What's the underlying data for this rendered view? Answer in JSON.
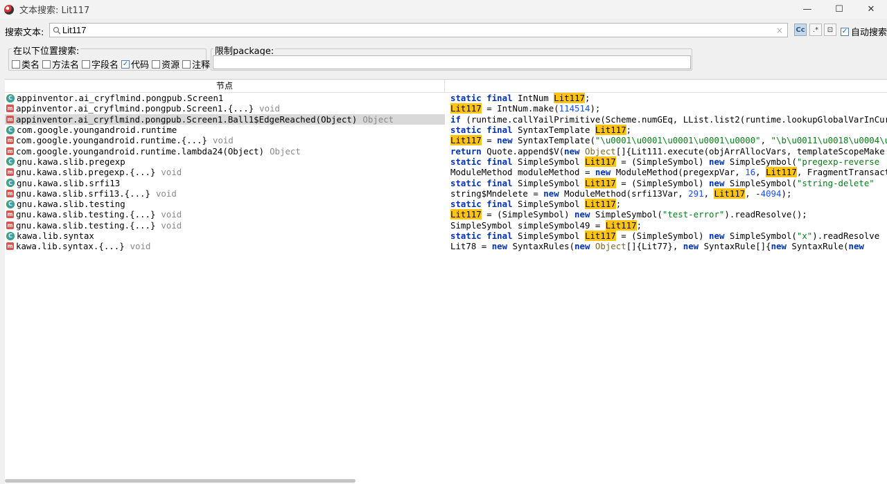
{
  "window": {
    "title": "文本搜索: Lit117",
    "minimize": "—",
    "maximize": "☐",
    "close": "✕"
  },
  "search": {
    "label": "搜索文本:",
    "value": "Lit117",
    "placeholder": "",
    "clear": "×",
    "case_btn": "Cc",
    "regex_btn": ".*",
    "word_btn": "⊡",
    "auto_label": "自动搜索",
    "auto_checked": true
  },
  "scope": {
    "title": "在以下位置搜索:",
    "options": [
      {
        "label": "类名",
        "checked": false
      },
      {
        "label": "方法名",
        "checked": false
      },
      {
        "label": "字段名",
        "checked": false
      },
      {
        "label": "代码",
        "checked": true
      },
      {
        "label": "资源",
        "checked": false
      },
      {
        "label": "注释",
        "checked": false
      }
    ]
  },
  "package": {
    "title": "限制package:",
    "value": ""
  },
  "table": {
    "header_node": "节点",
    "rows": [
      {
        "icon": "class",
        "node": "appinventor.ai_cryflmind.pongpub.Screen1",
        "type": "",
        "code": [
          [
            "kw",
            "static"
          ],
          [
            "t",
            " "
          ],
          [
            "kw",
            "final"
          ],
          [
            "t",
            " IntNum "
          ],
          [
            "hl",
            "Lit117"
          ],
          [
            "t",
            ";"
          ]
        ]
      },
      {
        "icon": "method",
        "node": "appinventor.ai_cryflmind.pongpub.Screen1.{...}",
        "type": "void",
        "code": [
          [
            "hl",
            "Lit117"
          ],
          [
            "t",
            " = IntNum.make("
          ],
          [
            "num",
            "114514"
          ],
          [
            "t",
            ");"
          ]
        ]
      },
      {
        "icon": "method",
        "node": "appinventor.ai_cryflmind.pongpub.Screen1.Ball1$EdgeReached(Object)",
        "type": "Object",
        "selected": true,
        "code": [
          [
            "kw",
            "if"
          ],
          [
            "t",
            " (runtime.callYailPrimitive(Scheme.numGEq, LList.list2(runtime.lookupGlobalVarInCur"
          ]
        ]
      },
      {
        "icon": "class",
        "node": "com.google.youngandroid.runtime",
        "type": "",
        "code": [
          [
            "kw",
            "static"
          ],
          [
            "t",
            " "
          ],
          [
            "kw",
            "final"
          ],
          [
            "t",
            " SyntaxTemplate "
          ],
          [
            "hl",
            "Lit117"
          ],
          [
            "t",
            ";"
          ]
        ]
      },
      {
        "icon": "method",
        "node": "com.google.youngandroid.runtime.{...}",
        "type": "void",
        "code": [
          [
            "hl",
            "Lit117"
          ],
          [
            "t",
            " = "
          ],
          [
            "kw",
            "new"
          ],
          [
            "t",
            " SyntaxTemplate("
          ],
          [
            "str",
            "\"\\u0001\\u0001\\u0001\\u0001\\u0000\""
          ],
          [
            "t",
            ", "
          ],
          [
            "str",
            "\"\\b\\u0011\\u0018\\u0004\\u0"
          ]
        ]
      },
      {
        "icon": "method",
        "node": "com.google.youngandroid.runtime.lambda24(Object)",
        "type": "Object",
        "code": [
          [
            "kw",
            "return"
          ],
          [
            "t",
            " Quote.append$V("
          ],
          [
            "kw",
            "new"
          ],
          [
            "t",
            " "
          ],
          [
            "tp",
            "Object"
          ],
          [
            "t",
            "[]{Lit111.execute(objArrAllocVars, templateScopeMake"
          ]
        ]
      },
      {
        "icon": "class",
        "node": "gnu.kawa.slib.pregexp",
        "type": "",
        "code": [
          [
            "kw",
            "static"
          ],
          [
            "t",
            " "
          ],
          [
            "kw",
            "final"
          ],
          [
            "t",
            " SimpleSymbol "
          ],
          [
            "hl",
            "Lit117"
          ],
          [
            "t",
            " = (SimpleSymbol) "
          ],
          [
            "kw",
            "new"
          ],
          [
            "t",
            " SimpleSymbol("
          ],
          [
            "str",
            "\"pregexp-reverse"
          ]
        ]
      },
      {
        "icon": "method",
        "node": "gnu.kawa.slib.pregexp.{...}",
        "type": "void",
        "code": [
          [
            "t",
            "ModuleMethod moduleMethod = "
          ],
          [
            "kw",
            "new"
          ],
          [
            "t",
            " ModuleMethod(pregexpVar, "
          ],
          [
            "num",
            "16"
          ],
          [
            "t",
            ", "
          ],
          [
            "hl",
            "Lit117"
          ],
          [
            "t",
            ", FragmentTransact"
          ]
        ]
      },
      {
        "icon": "class",
        "node": "gnu.kawa.slib.srfi13",
        "type": "",
        "code": [
          [
            "kw",
            "static"
          ],
          [
            "t",
            " "
          ],
          [
            "kw",
            "final"
          ],
          [
            "t",
            " SimpleSymbol "
          ],
          [
            "hl",
            "Lit117"
          ],
          [
            "t",
            " = (SimpleSymbol) "
          ],
          [
            "kw",
            "new"
          ],
          [
            "t",
            " SimpleSymbol("
          ],
          [
            "str",
            "\"string-delete\""
          ]
        ]
      },
      {
        "icon": "method",
        "node": "gnu.kawa.slib.srfi13.{...}",
        "type": "void",
        "code": [
          [
            "t",
            "string$Mndelete = "
          ],
          [
            "kw",
            "new"
          ],
          [
            "t",
            " ModuleMethod(srfi13Var, "
          ],
          [
            "num",
            "291"
          ],
          [
            "t",
            ", "
          ],
          [
            "hl",
            "Lit117"
          ],
          [
            "t",
            ", -"
          ],
          [
            "num",
            "4094"
          ],
          [
            "t",
            ");"
          ]
        ]
      },
      {
        "icon": "class",
        "node": "gnu.kawa.slib.testing",
        "type": "",
        "code": [
          [
            "kw",
            "static"
          ],
          [
            "t",
            " "
          ],
          [
            "kw",
            "final"
          ],
          [
            "t",
            " SimpleSymbol "
          ],
          [
            "hl",
            "Lit117"
          ],
          [
            "t",
            ";"
          ]
        ]
      },
      {
        "icon": "method",
        "node": "gnu.kawa.slib.testing.{...}",
        "type": "void",
        "code": [
          [
            "hl",
            "Lit117"
          ],
          [
            "t",
            " = (SimpleSymbol) "
          ],
          [
            "kw",
            "new"
          ],
          [
            "t",
            " SimpleSymbol("
          ],
          [
            "str",
            "\"test-error\""
          ],
          [
            "t",
            ").readResolve();"
          ]
        ]
      },
      {
        "icon": "method",
        "node": "gnu.kawa.slib.testing.{...}",
        "type": "void",
        "code": [
          [
            "t",
            "SimpleSymbol simpleSymbol49 = "
          ],
          [
            "hl",
            "Lit117"
          ],
          [
            "t",
            ";"
          ]
        ]
      },
      {
        "icon": "class",
        "node": "kawa.lib.syntax",
        "type": "",
        "code": [
          [
            "kw",
            "static"
          ],
          [
            "t",
            " "
          ],
          [
            "kw",
            "final"
          ],
          [
            "t",
            " SimpleSymbol "
          ],
          [
            "hl",
            "Lit117"
          ],
          [
            "t",
            " = (SimpleSymbol) "
          ],
          [
            "kw",
            "new"
          ],
          [
            "t",
            " SimpleSymbol("
          ],
          [
            "str",
            "\"x\""
          ],
          [
            "t",
            ").readResolve"
          ]
        ]
      },
      {
        "icon": "method",
        "node": "kawa.lib.syntax.{...}",
        "type": "void",
        "code": [
          [
            "t",
            "Lit78 = "
          ],
          [
            "kw",
            "new"
          ],
          [
            "t",
            " SyntaxRules("
          ],
          [
            "kw",
            "new"
          ],
          [
            "t",
            " "
          ],
          [
            "tp",
            "Object"
          ],
          [
            "t",
            "[]{Lit77}, "
          ],
          [
            "kw",
            "new"
          ],
          [
            "t",
            " SyntaxRule[]{"
          ],
          [
            "kw",
            "new"
          ],
          [
            "t",
            " SyntaxRule("
          ],
          [
            "kw",
            "new"
          ],
          [
            "t",
            " "
          ]
        ]
      }
    ]
  }
}
